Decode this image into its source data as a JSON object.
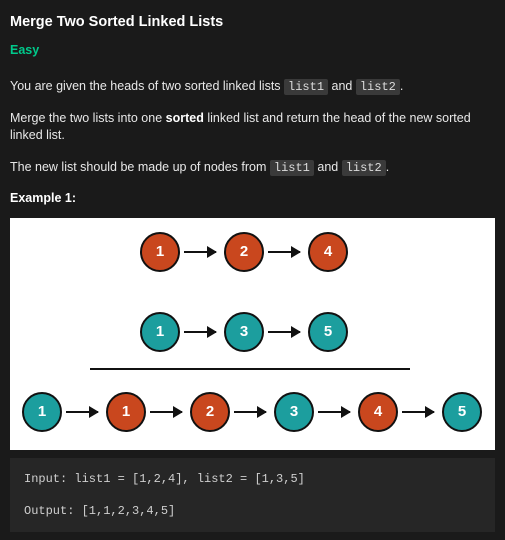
{
  "title": "Merge Two Sorted Linked Lists",
  "difficulty": "Easy",
  "desc": {
    "p1_a": "You are given the heads of two sorted linked lists ",
    "p1_code1": "list1",
    "p1_b": " and ",
    "p1_code2": "list2",
    "p1_c": ".",
    "p2_a": "Merge the two lists into one ",
    "p2_bold": "sorted",
    "p2_b": " linked list and return the head of the new sorted linked list.",
    "p3_a": "The new list should be made up of nodes from ",
    "p3_code1": "list1",
    "p3_b": " and ",
    "p3_code2": "list2",
    "p3_c": "."
  },
  "example_label": "Example 1:",
  "diagram": {
    "row1": [
      "1",
      "2",
      "4"
    ],
    "row2": [
      "1",
      "3",
      "5"
    ],
    "row3": [
      "1",
      "1",
      "2",
      "3",
      "4",
      "5"
    ]
  },
  "codeblock": {
    "line1": "Input: list1 = [1,2,4], list2 = [1,3,5]",
    "line2": "Output: [1,1,2,3,4,5]"
  }
}
